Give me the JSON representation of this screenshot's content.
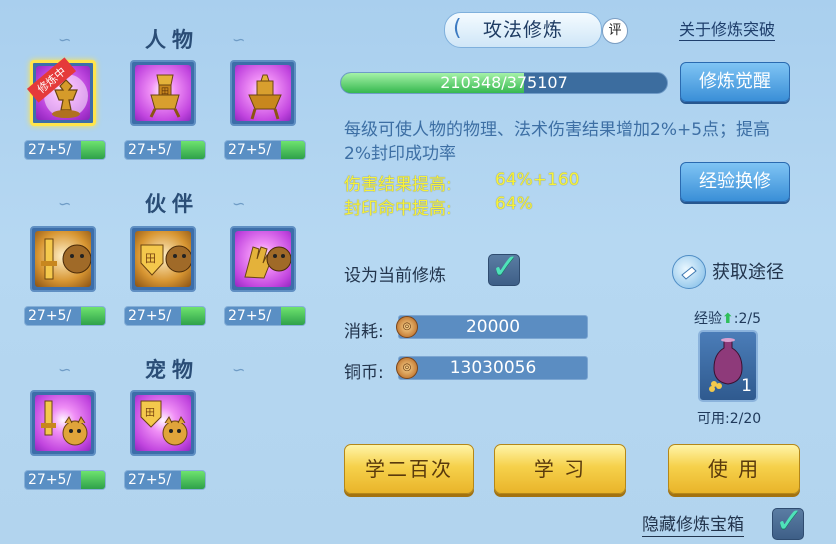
{
  "left_panel": {
    "sections": [
      {
        "title": "人物",
        "items": [
          {
            "level": "27+5/",
            "tag": "修炼中",
            "icon": "character-attack-icon"
          },
          {
            "level": "27+5/",
            "icon": "character-defense-icon"
          },
          {
            "level": "27+5/",
            "icon": "character-magic-icon"
          }
        ]
      },
      {
        "title": "伙伴",
        "items": [
          {
            "level": "27+5/",
            "icon": "partner-attack-icon"
          },
          {
            "level": "27+5/",
            "icon": "partner-defense-icon"
          },
          {
            "level": "27+5/",
            "icon": "partner-magic-icon"
          }
        ]
      },
      {
        "title": "宠物",
        "items": [
          {
            "level": "27+5/",
            "icon": "pet-attack-icon"
          },
          {
            "level": "27+5/",
            "icon": "pet-defense-icon"
          }
        ]
      }
    ]
  },
  "header": {
    "title": "攻法修炼",
    "rate_badge": "评",
    "about_link": "关于修炼突破"
  },
  "progress": {
    "text": "210348/375107",
    "current": 210348,
    "max": 375107
  },
  "buttons": {
    "awaken": "修炼觉醒",
    "exchange": "经验换修",
    "learn_200": "学二百次",
    "learn": "学 习",
    "use": "使 用"
  },
  "description": "每级可使人物的物理、法术伤害结果增加2%+5点；提高2%封印成功率",
  "effects": [
    {
      "label": "伤害结果提高:",
      "value": "64%+160"
    },
    {
      "label": "封印命中提高:",
      "value": "64%"
    }
  ],
  "set_current": {
    "label": "设为当前修炼",
    "checked": true
  },
  "acquire": {
    "label": "获取途径"
  },
  "cost": {
    "label": "消耗:",
    "value": "20000"
  },
  "coins": {
    "label": "铜币:",
    "value": "13030056"
  },
  "item": {
    "exp_label": "经验",
    "exp_value": ":2/5",
    "count": "1",
    "available": "可用:2/20",
    "icon": "vase-icon"
  },
  "hide_box": {
    "label": "隐藏修炼宝箱",
    "checked": true
  },
  "colors": {
    "background": "#b6d8f2",
    "accent_blue": "#3a8fd7",
    "gold_button": "#f6d14b",
    "effect_yellow": "#f7f23a",
    "progress_green": "#36b84f"
  }
}
